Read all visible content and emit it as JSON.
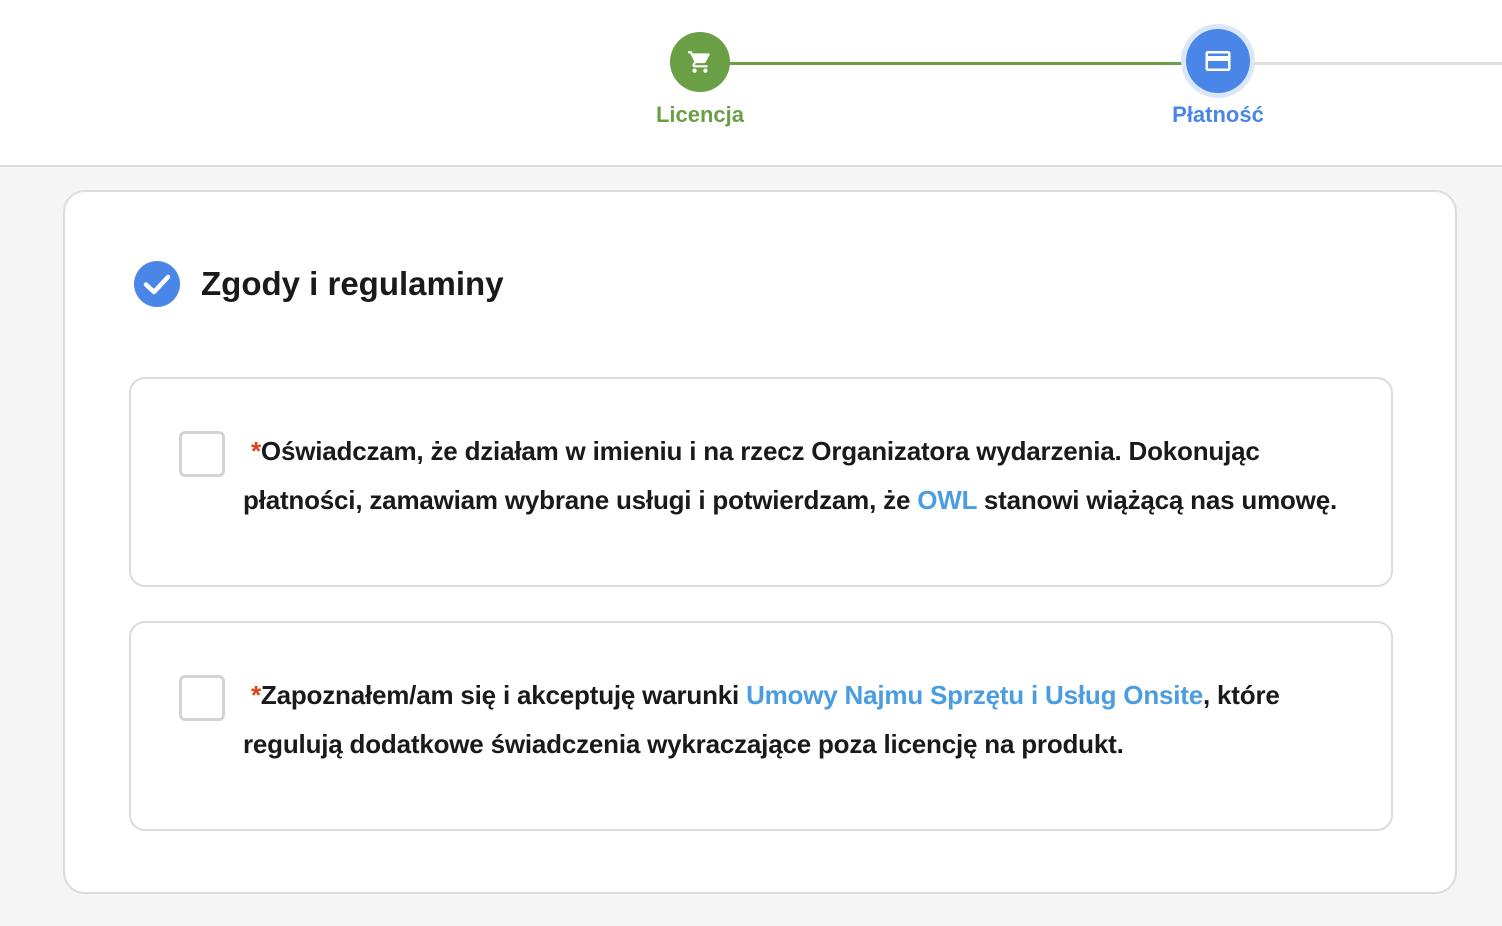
{
  "stepper": {
    "steps": [
      {
        "label": "Licencja",
        "icon": "cart-icon",
        "state": "completed",
        "color": "#6a9f45"
      },
      {
        "label": "Płatność",
        "icon": "credit-card-icon",
        "state": "active",
        "color": "#4a86e8"
      }
    ]
  },
  "section": {
    "title": "Zgody i regulaminy",
    "icon": "check-circle-icon",
    "icon_color": "#4a86e8"
  },
  "consents": [
    {
      "required_mark": "*",
      "text_before": "Oświadczam, że działam w imieniu i na rzecz Organizatora wydarzenia. Dokonując płatności, zamawiam wybrane usługi i potwierdzam, że ",
      "link_text": "OWL",
      "text_after": " stanowi wiążącą nas umowę.",
      "checked": false
    },
    {
      "required_mark": "*",
      "text_before": "Zapoznałem/am się i akceptuję warunki ",
      "link_text": "Umowy Najmu Sprzętu i Usług Onsite",
      "text_after": ", które regulują dodatkowe świadczenia wykraczające poza licencję na produkt.",
      "checked": false
    }
  ],
  "colors": {
    "link": "#4a9de0",
    "required": "#d84315"
  }
}
